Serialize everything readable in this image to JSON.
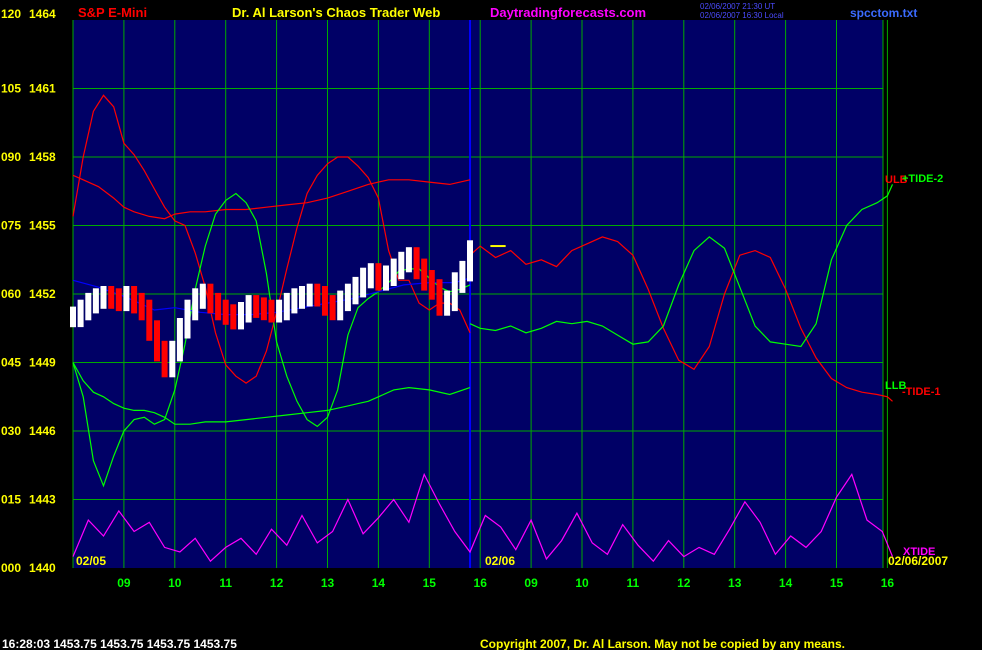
{
  "header": {
    "left": "S&P E-Mini",
    "center": "Dr. Al Larson's Chaos Trader Web",
    "site": "Daytradingforecasts.com",
    "stamp_line1": "02/06/2007 21:30 UT",
    "stamp_line2": "02/06/2007 16:30 Local",
    "file": "spcctom.txt"
  },
  "footer": {
    "quote": "16:28:03  1453.75  1453.75  1453.75  1453.75",
    "copyright": "Copyright 2007, Dr. Al Larson. May not be copied by any means."
  },
  "colors": {
    "plot_bg": "#000066",
    "grid": "#00aa00",
    "axis_text": "#ffff00",
    "hour_text": "#00ff00",
    "red_line": "#ff0000",
    "green_line": "#00ff00",
    "blue_line": "#0000ff",
    "magenta_line": "#ff00ff",
    "divider": "#0000ff"
  },
  "chart_data": {
    "type": "line",
    "y_ticks": [
      {
        "left": "120",
        "right": "1464"
      },
      {
        "left": "105",
        "right": "1461"
      },
      {
        "left": "090",
        "right": "1458"
      },
      {
        "left": "075",
        "right": "1455"
      },
      {
        "left": "060",
        "right": "1452"
      },
      {
        "left": "045",
        "right": "1449"
      },
      {
        "left": "030",
        "right": "1446"
      },
      {
        "left": "015",
        "right": "1443"
      },
      {
        "left": "000",
        "right": "1440"
      }
    ],
    "ylim": [
      1440,
      1464
    ],
    "hour_labels": [
      "09",
      "10",
      "11",
      "12",
      "13",
      "14",
      "15",
      "16",
      "09",
      "10",
      "11",
      "12",
      "13",
      "14",
      "15",
      "16"
    ],
    "date_labels": {
      "day1": "02/05",
      "day2": "02/06",
      "end": "02/06/2007"
    },
    "line_labels": {
      "ulb": "ULB",
      "tide2": "+TIDE-2",
      "llb": "LLB",
      "tide1": "-TIDE-1",
      "xtide": "XTIDE"
    },
    "price_marker": 1454.1,
    "price_bars": {
      "x_range": [
        0,
        7.8
      ],
      "values": [
        1451.0,
        1451.3,
        1451.6,
        1451.8,
        1451.9,
        1451.8,
        1451.7,
        1451.9,
        1451.6,
        1451.3,
        1450.4,
        1449.5,
        1448.8,
        1449.5,
        1450.5,
        1451.3,
        1451.8,
        1452.0,
        1451.6,
        1451.3,
        1451.1,
        1450.9,
        1451.2,
        1451.5,
        1451.4,
        1451.3,
        1451.2,
        1451.3,
        1451.6,
        1451.8,
        1451.9,
        1452.0,
        1451.9,
        1451.5,
        1451.3,
        1451.7,
        1452.0,
        1452.3,
        1452.7,
        1452.9,
        1452.6,
        1452.8,
        1453.1,
        1453.4,
        1453.6,
        1453.1,
        1452.6,
        1452.2,
        1451.5,
        1451.7,
        1452.5,
        1453.0,
        1453.9
      ]
    },
    "series": [
      {
        "key": "red_upper",
        "color": "red_line",
        "x": [
          0,
          0.2,
          0.5,
          0.8,
          1.0,
          1.2,
          1.5,
          1.8,
          2.0,
          2.3,
          2.6,
          3.0,
          3.4,
          3.8,
          4.2,
          4.6,
          5.0,
          5.4,
          5.8,
          6.2,
          6.6,
          7.0,
          7.4,
          7.8
        ],
        "y": [
          1457.2,
          1457.0,
          1456.7,
          1456.2,
          1455.8,
          1455.6,
          1455.4,
          1455.3,
          1455.5,
          1455.6,
          1455.6,
          1455.7,
          1455.7,
          1455.8,
          1455.9,
          1456.0,
          1456.2,
          1456.5,
          1456.8,
          1457.0,
          1457.0,
          1456.9,
          1456.8,
          1457.0
        ]
      },
      {
        "key": "red_lower",
        "color": "red_line",
        "x": [
          0,
          0.2,
          0.4,
          0.6,
          0.8,
          1.0,
          1.2,
          1.4,
          1.6,
          1.8,
          2.0,
          2.2,
          2.4,
          2.6,
          2.8,
          3.0,
          3.2,
          3.4,
          3.6,
          3.8,
          4.0,
          4.2,
          4.4,
          4.6,
          4.8,
          5.0,
          5.2,
          5.4,
          5.6,
          5.8,
          6.0,
          6.2,
          6.4,
          6.6,
          6.8,
          7.0,
          7.2,
          7.4,
          7.6,
          7.8
        ],
        "y": [
          1455.4,
          1458.0,
          1460.0,
          1460.7,
          1460.2,
          1458.6,
          1458.1,
          1457.4,
          1456.6,
          1455.8,
          1455.2,
          1455.0,
          1453.8,
          1452.3,
          1450.3,
          1448.9,
          1448.4,
          1448.1,
          1448.4,
          1449.5,
          1451.2,
          1453.1,
          1454.9,
          1456.4,
          1457.2,
          1457.7,
          1458.0,
          1458.0,
          1457.6,
          1457.1,
          1456.2,
          1453.9,
          1452.6,
          1452.6,
          1451.6,
          1451.3,
          1451.6,
          1451.6,
          1451.3,
          1450.3
        ]
      },
      {
        "key": "green_lower",
        "color": "green_line",
        "x": [
          0,
          0.2,
          0.4,
          0.6,
          0.8,
          1.0,
          1.2,
          1.4,
          1.6,
          1.8,
          2.0,
          2.3,
          2.6,
          3.0,
          3.4,
          3.8,
          4.2,
          4.6,
          5.0,
          5.2,
          5.4,
          5.6,
          5.8,
          6.0,
          6.3,
          6.6,
          7.0,
          7.4,
          7.8
        ],
        "y": [
          1449.0,
          1448.2,
          1447.7,
          1447.5,
          1447.2,
          1447.0,
          1446.9,
          1446.9,
          1446.8,
          1446.6,
          1446.3,
          1446.3,
          1446.4,
          1446.4,
          1446.5,
          1446.6,
          1446.7,
          1446.8,
          1446.9,
          1447.0,
          1447.1,
          1447.2,
          1447.3,
          1447.5,
          1447.8,
          1447.9,
          1447.8,
          1447.6,
          1447.9
        ]
      },
      {
        "key": "green_wave",
        "color": "green_line",
        "x": [
          0,
          0.2,
          0.4,
          0.6,
          0.8,
          1.0,
          1.2,
          1.4,
          1.6,
          1.8,
          2.0,
          2.2,
          2.4,
          2.6,
          2.8,
          3.0,
          3.2,
          3.4,
          3.6,
          3.8,
          4.0,
          4.2,
          4.4,
          4.6,
          4.8,
          5.0,
          5.2,
          5.4,
          5.6,
          5.8,
          6.0,
          6.2,
          6.4,
          6.6,
          6.8,
          7.0,
          7.2,
          7.4,
          7.6,
          7.8
        ],
        "y": [
          1449.0,
          1447.5,
          1444.7,
          1443.6,
          1444.9,
          1446.0,
          1446.5,
          1446.6,
          1446.3,
          1446.5,
          1447.8,
          1449.8,
          1452.2,
          1454.1,
          1455.5,
          1456.1,
          1456.4,
          1456.0,
          1455.2,
          1452.9,
          1449.9,
          1448.4,
          1447.3,
          1446.5,
          1446.2,
          1446.6,
          1447.8,
          1450.2,
          1451.4,
          1451.8,
          1452.1,
          1452.5,
          1453.0,
          1453.1,
          1453.1,
          1452.7,
          1452.3,
          1452.1,
          1452.2,
          1452.4
        ]
      },
      {
        "key": "red_tide1",
        "color": "red_line",
        "x": [
          7.8,
          8.0,
          8.3,
          8.6,
          8.9,
          9.2,
          9.5,
          9.8,
          10.1,
          10.4,
          10.7,
          11.0,
          11.3,
          11.6,
          11.9,
          12.2,
          12.5,
          12.8,
          13.1,
          13.4,
          13.7,
          14.0,
          14.3,
          14.6,
          14.9,
          15.2,
          15.5,
          15.8,
          16.0,
          16.1
        ],
        "y": [
          1453.7,
          1454.1,
          1453.6,
          1453.9,
          1453.3,
          1453.5,
          1453.2,
          1453.9,
          1454.2,
          1454.5,
          1454.3,
          1453.7,
          1452.2,
          1450.5,
          1449.1,
          1448.7,
          1449.7,
          1452.0,
          1453.7,
          1453.9,
          1453.6,
          1452.2,
          1450.5,
          1449.2,
          1448.3,
          1447.9,
          1447.7,
          1447.6,
          1447.5,
          1447.3
        ]
      },
      {
        "key": "green_tide2",
        "color": "green_line",
        "x": [
          7.8,
          8.0,
          8.3,
          8.6,
          8.9,
          9.2,
          9.5,
          9.8,
          10.1,
          10.4,
          10.7,
          11.0,
          11.3,
          11.6,
          11.9,
          12.2,
          12.5,
          12.8,
          13.1,
          13.4,
          13.7,
          14.0,
          14.3,
          14.6,
          14.9,
          15.2,
          15.5,
          15.8,
          16.0,
          16.1
        ],
        "y": [
          1450.7,
          1450.5,
          1450.4,
          1450.6,
          1450.3,
          1450.5,
          1450.8,
          1450.7,
          1450.8,
          1450.6,
          1450.2,
          1449.8,
          1449.9,
          1450.6,
          1452.4,
          1453.9,
          1454.5,
          1454.0,
          1452.3,
          1450.6,
          1449.9,
          1449.8,
          1449.7,
          1450.7,
          1453.5,
          1455.0,
          1455.7,
          1456.0,
          1456.3,
          1456.8
        ]
      },
      {
        "key": "blue_smooth",
        "color": "blue_line",
        "x": [
          0,
          0.5,
          1.0,
          1.3,
          1.6,
          2.0,
          2.5,
          3.0,
          3.5,
          4.0,
          4.5,
          5.0,
          5.5,
          6.0,
          6.5,
          7.0,
          7.5,
          7.8
        ],
        "y": [
          1452.6,
          1452.3,
          1451.9,
          1451.6,
          1451.3,
          1451.4,
          1451.2,
          1451.1,
          1451.1,
          1451.2,
          1451.4,
          1451.6,
          1451.8,
          1452.1,
          1452.4,
          1452.5,
          1452.5,
          1452.7
        ]
      },
      {
        "key": "xtide",
        "color": "magenta_line",
        "x": [
          0,
          0.3,
          0.6,
          0.9,
          1.2,
          1.5,
          1.8,
          2.1,
          2.4,
          2.7,
          3.0,
          3.3,
          3.6,
          3.9,
          4.2,
          4.5,
          4.8,
          5.1,
          5.4,
          5.7,
          6.0,
          6.3,
          6.6,
          6.9,
          7.2,
          7.5,
          7.8,
          8.1,
          8.4,
          8.7,
          9.0,
          9.3,
          9.6,
          9.9,
          10.2,
          10.5,
          10.8,
          11.1,
          11.4,
          11.7,
          12.0,
          12.3,
          12.6,
          12.9,
          13.2,
          13.5,
          13.8,
          14.1,
          14.4,
          14.7,
          15.0,
          15.3,
          15.6,
          15.9,
          16.1
        ],
        "y": [
          1440.5,
          1442.1,
          1441.4,
          1442.5,
          1441.6,
          1442.0,
          1440.9,
          1440.7,
          1441.3,
          1440.3,
          1440.9,
          1441.3,
          1440.6,
          1441.7,
          1441.0,
          1442.3,
          1441.1,
          1441.6,
          1443.0,
          1441.5,
          1442.2,
          1443.0,
          1442.0,
          1444.1,
          1442.8,
          1441.6,
          1440.7,
          1442.3,
          1441.8,
          1440.8,
          1442.1,
          1440.4,
          1441.2,
          1442.4,
          1441.1,
          1440.6,
          1441.9,
          1441.0,
          1440.3,
          1441.2,
          1440.5,
          1440.9,
          1440.6,
          1441.7,
          1442.9,
          1442.0,
          1440.6,
          1441.4,
          1440.9,
          1441.6,
          1443.1,
          1444.1,
          1442.1,
          1441.6,
          1440.5
        ]
      }
    ]
  }
}
